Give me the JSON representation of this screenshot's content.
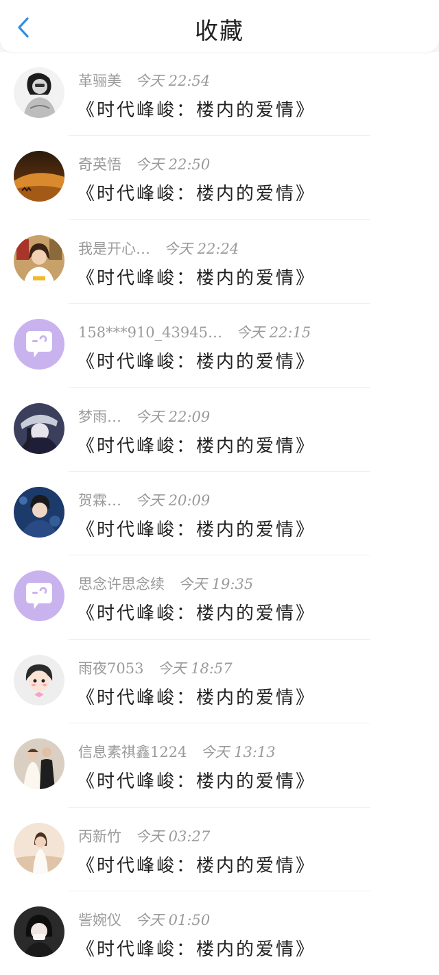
{
  "header": {
    "title": "收藏",
    "back_icon": "chevron-left-icon",
    "accent_color": "#2f8fe0"
  },
  "items": [
    {
      "name": "革骊美",
      "time": "今天 22:54",
      "content": "《时代峰峻：楼内的爱情》",
      "avatar": "photo-avatar"
    },
    {
      "name": "奇英悟",
      "time": "今天 22:50",
      "content": "《时代峰峻：楼内的爱情》",
      "avatar": "photo-avatar"
    },
    {
      "name": "我是开心…",
      "time": "今天 22:24",
      "content": "《时代峰峻：楼内的爱情》",
      "avatar": "photo-avatar"
    },
    {
      "name": "158***910_43945…",
      "time": "今天 22:15",
      "content": "《时代峰峻：楼内的爱情》",
      "avatar": "default-chat-avatar"
    },
    {
      "name": "梦雨…",
      "time": "今天 22:09",
      "content": "《时代峰峻：楼内的爱情》",
      "avatar": "photo-avatar"
    },
    {
      "name": "贺霖…",
      "time": "今天 20:09",
      "content": "《时代峰峻：楼内的爱情》",
      "avatar": "photo-avatar"
    },
    {
      "name": "思念许思念续",
      "time": "今天 19:35",
      "content": "《时代峰峻：楼内的爱情》",
      "avatar": "default-chat-avatar"
    },
    {
      "name": "雨夜7053",
      "time": "今天 18:57",
      "content": "《时代峰峻：楼内的爱情》",
      "avatar": "cartoon-avatar"
    },
    {
      "name": "信息素祺鑫1224",
      "time": "今天 13:13",
      "content": "《时代峰峻：楼内的爱情》",
      "avatar": "photo-avatar"
    },
    {
      "name": "丙新竹",
      "time": "今天 03:27",
      "content": "《时代峰峻：楼内的爱情》",
      "avatar": "photo-avatar"
    },
    {
      "name": "訾婉仪",
      "time": "今天 01:50",
      "content": "《时代峰峻：楼内的爱情》",
      "avatar": "photo-avatar"
    }
  ]
}
